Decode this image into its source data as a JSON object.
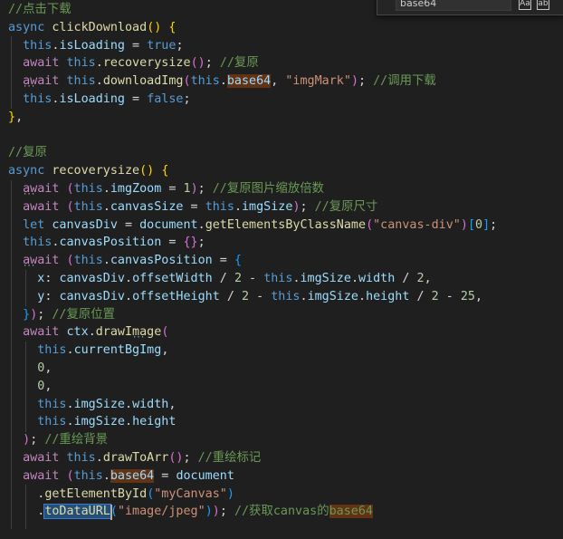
{
  "find_widget": {
    "query": "base64"
  },
  "code": {
    "lines": [
      [
        [
          "c",
          "//点击下载"
        ]
      ],
      [
        [
          "k",
          "async "
        ],
        [
          "f",
          "clickDownload"
        ],
        [
          "y",
          "()"
        ],
        [
          "p",
          " "
        ],
        [
          "y",
          "{"
        ]
      ],
      [
        [
          "p",
          "  "
        ],
        [
          "k",
          "this"
        ],
        [
          "p",
          "."
        ],
        [
          "v",
          "isLoading"
        ],
        [
          "p",
          " = "
        ],
        [
          "k",
          "true"
        ],
        [
          "p",
          ";"
        ]
      ],
      [
        [
          "p",
          "  "
        ],
        [
          "kc",
          "await "
        ],
        [
          "k",
          "this"
        ],
        [
          "p",
          "."
        ],
        [
          "f",
          "recoverysize"
        ],
        [
          "pk",
          "()"
        ],
        [
          "p",
          "; "
        ],
        [
          "c",
          "//复原"
        ]
      ],
      [
        [
          "p",
          "  "
        ],
        [
          "kc",
          "await "
        ],
        [
          "k",
          "this"
        ],
        [
          "p",
          "."
        ],
        [
          "f",
          "downloadImg"
        ],
        [
          "pk",
          "("
        ],
        [
          "k",
          "this"
        ],
        [
          "p",
          "."
        ],
        [
          "v",
          "base64",
          "find"
        ],
        [
          "p",
          ", "
        ],
        [
          "s",
          "\"imgMark\""
        ],
        [
          "pk",
          ")"
        ],
        [
          "p",
          "; "
        ],
        [
          "c",
          "//调用下载"
        ]
      ],
      [
        [
          "p",
          "  "
        ],
        [
          "k",
          "this"
        ],
        [
          "p",
          "."
        ],
        [
          "v",
          "isLoading"
        ],
        [
          "p",
          " = "
        ],
        [
          "k",
          "false"
        ],
        [
          "p",
          ";"
        ]
      ],
      [
        [
          "y",
          "}"
        ],
        [
          "p",
          ","
        ]
      ],
      [
        [
          "p",
          ""
        ]
      ],
      [
        [
          "c",
          "//复原"
        ]
      ],
      [
        [
          "k",
          "async "
        ],
        [
          "f",
          "recoverysize"
        ],
        [
          "y",
          "()"
        ],
        [
          "p",
          " "
        ],
        [
          "y",
          "{"
        ]
      ],
      [
        [
          "p",
          "  "
        ],
        [
          "kc",
          "await "
        ],
        [
          "pk",
          "("
        ],
        [
          "k",
          "this"
        ],
        [
          "p",
          "."
        ],
        [
          "v",
          "imgZoom"
        ],
        [
          "p",
          " = "
        ],
        [
          "n",
          "1"
        ],
        [
          "pk",
          ")"
        ],
        [
          "p",
          "; "
        ],
        [
          "c",
          "//复原图片缩放倍数"
        ]
      ],
      [
        [
          "p",
          "  "
        ],
        [
          "kc",
          "await "
        ],
        [
          "pk",
          "("
        ],
        [
          "k",
          "this"
        ],
        [
          "p",
          "."
        ],
        [
          "v",
          "canvasSize"
        ],
        [
          "p",
          " = "
        ],
        [
          "k",
          "this"
        ],
        [
          "p",
          "."
        ],
        [
          "v",
          "imgSize"
        ],
        [
          "pk",
          ")"
        ],
        [
          "p",
          "; "
        ],
        [
          "c",
          "//复原尺寸"
        ]
      ],
      [
        [
          "p",
          "  "
        ],
        [
          "k",
          "let "
        ],
        [
          "v",
          "canvasDiv"
        ],
        [
          "p",
          " = "
        ],
        [
          "v",
          "document"
        ],
        [
          "p",
          "."
        ],
        [
          "f",
          "getElementsByClassName"
        ],
        [
          "pk",
          "("
        ],
        [
          "s",
          "\"canvas-div\""
        ],
        [
          "pk",
          ")"
        ],
        [
          "bl",
          "["
        ],
        [
          "n",
          "0"
        ],
        [
          "bl",
          "]"
        ],
        [
          "p",
          ";"
        ]
      ],
      [
        [
          "p",
          "  "
        ],
        [
          "k",
          "this"
        ],
        [
          "p",
          "."
        ],
        [
          "v",
          "canvasPosition"
        ],
        [
          "p",
          " = "
        ],
        [
          "pk",
          "{}"
        ],
        [
          "p",
          ";"
        ]
      ],
      [
        [
          "p",
          "  "
        ],
        [
          "kc",
          "await "
        ],
        [
          "pk",
          "("
        ],
        [
          "k",
          "this"
        ],
        [
          "p",
          "."
        ],
        [
          "v",
          "canvasPosition"
        ],
        [
          "p",
          " = "
        ],
        [
          "bl",
          "{"
        ]
      ],
      [
        [
          "p",
          "    "
        ],
        [
          "v",
          "x"
        ],
        [
          "p",
          ": "
        ],
        [
          "v",
          "canvasDiv"
        ],
        [
          "p",
          "."
        ],
        [
          "v",
          "offsetWidth"
        ],
        [
          "p",
          " / "
        ],
        [
          "n",
          "2"
        ],
        [
          "p",
          " - "
        ],
        [
          "k",
          "this"
        ],
        [
          "p",
          "."
        ],
        [
          "v",
          "imgSize"
        ],
        [
          "p",
          "."
        ],
        [
          "v",
          "width"
        ],
        [
          "p",
          " / "
        ],
        [
          "n",
          "2"
        ],
        [
          "p",
          ","
        ]
      ],
      [
        [
          "p",
          "    "
        ],
        [
          "v",
          "y"
        ],
        [
          "p",
          ": "
        ],
        [
          "v",
          "canvasDiv"
        ],
        [
          "p",
          "."
        ],
        [
          "v",
          "offsetHeight"
        ],
        [
          "p",
          " / "
        ],
        [
          "n",
          "2"
        ],
        [
          "p",
          " - "
        ],
        [
          "k",
          "this"
        ],
        [
          "p",
          "."
        ],
        [
          "v",
          "imgSize"
        ],
        [
          "p",
          "."
        ],
        [
          "v",
          "height"
        ],
        [
          "p",
          " / "
        ],
        [
          "n",
          "2"
        ],
        [
          "p",
          " - "
        ],
        [
          "n",
          "25"
        ],
        [
          "p",
          ","
        ]
      ],
      [
        [
          "p",
          "  "
        ],
        [
          "bl",
          "}"
        ],
        [
          "pk",
          ")"
        ],
        [
          "p",
          "; "
        ],
        [
          "c",
          "//复原位置"
        ]
      ],
      [
        [
          "p",
          "  "
        ],
        [
          "kc",
          "await "
        ],
        [
          "v",
          "ctx"
        ],
        [
          "p",
          "."
        ],
        [
          "f",
          "drawImage"
        ],
        [
          "pk",
          "("
        ]
      ],
      [
        [
          "p",
          "    "
        ],
        [
          "k",
          "this"
        ],
        [
          "p",
          "."
        ],
        [
          "v",
          "currentBgImg"
        ],
        [
          "p",
          ","
        ]
      ],
      [
        [
          "p",
          "    "
        ],
        [
          "n",
          "0"
        ],
        [
          "p",
          ","
        ]
      ],
      [
        [
          "p",
          "    "
        ],
        [
          "n",
          "0"
        ],
        [
          "p",
          ","
        ]
      ],
      [
        [
          "p",
          "    "
        ],
        [
          "k",
          "this"
        ],
        [
          "p",
          "."
        ],
        [
          "v",
          "imgSize"
        ],
        [
          "p",
          "."
        ],
        [
          "v",
          "width"
        ],
        [
          "p",
          ","
        ]
      ],
      [
        [
          "p",
          "    "
        ],
        [
          "k",
          "this"
        ],
        [
          "p",
          "."
        ],
        [
          "v",
          "imgSize"
        ],
        [
          "p",
          "."
        ],
        [
          "v",
          "height"
        ]
      ],
      [
        [
          "p",
          "  "
        ],
        [
          "pk",
          ")"
        ],
        [
          "p",
          "; "
        ],
        [
          "c",
          "//重绘背景"
        ]
      ],
      [
        [
          "p",
          "  "
        ],
        [
          "kc",
          "await "
        ],
        [
          "k",
          "this"
        ],
        [
          "p",
          "."
        ],
        [
          "f",
          "drawToArr"
        ],
        [
          "pk",
          "()"
        ],
        [
          "p",
          "; "
        ],
        [
          "c",
          "//重绘标记"
        ]
      ],
      [
        [
          "p",
          "  "
        ],
        [
          "kc",
          "await "
        ],
        [
          "pk",
          "("
        ],
        [
          "k",
          "this"
        ],
        [
          "p",
          "."
        ],
        [
          "v",
          "base64",
          "find"
        ],
        [
          "p",
          " = "
        ],
        [
          "v",
          "document"
        ]
      ],
      [
        [
          "p",
          "    ."
        ],
        [
          "f",
          "getElementById"
        ],
        [
          "bl",
          "("
        ],
        [
          "s",
          "\"myCanvas\""
        ],
        [
          "bl",
          ")"
        ]
      ],
      [
        [
          "p",
          "    ."
        ],
        [
          "f",
          "toDataURL",
          "sel"
        ],
        [
          "bl",
          "("
        ],
        [
          "s",
          "\"image/jpeg\""
        ],
        [
          "bl",
          ")"
        ],
        [
          "pk",
          ")"
        ],
        [
          "p",
          "; "
        ],
        [
          "c",
          "//获取canvas的"
        ],
        [
          "c",
          "base64",
          "find"
        ]
      ],
      [
        [
          "p",
          "  "
        ]
      ]
    ]
  }
}
